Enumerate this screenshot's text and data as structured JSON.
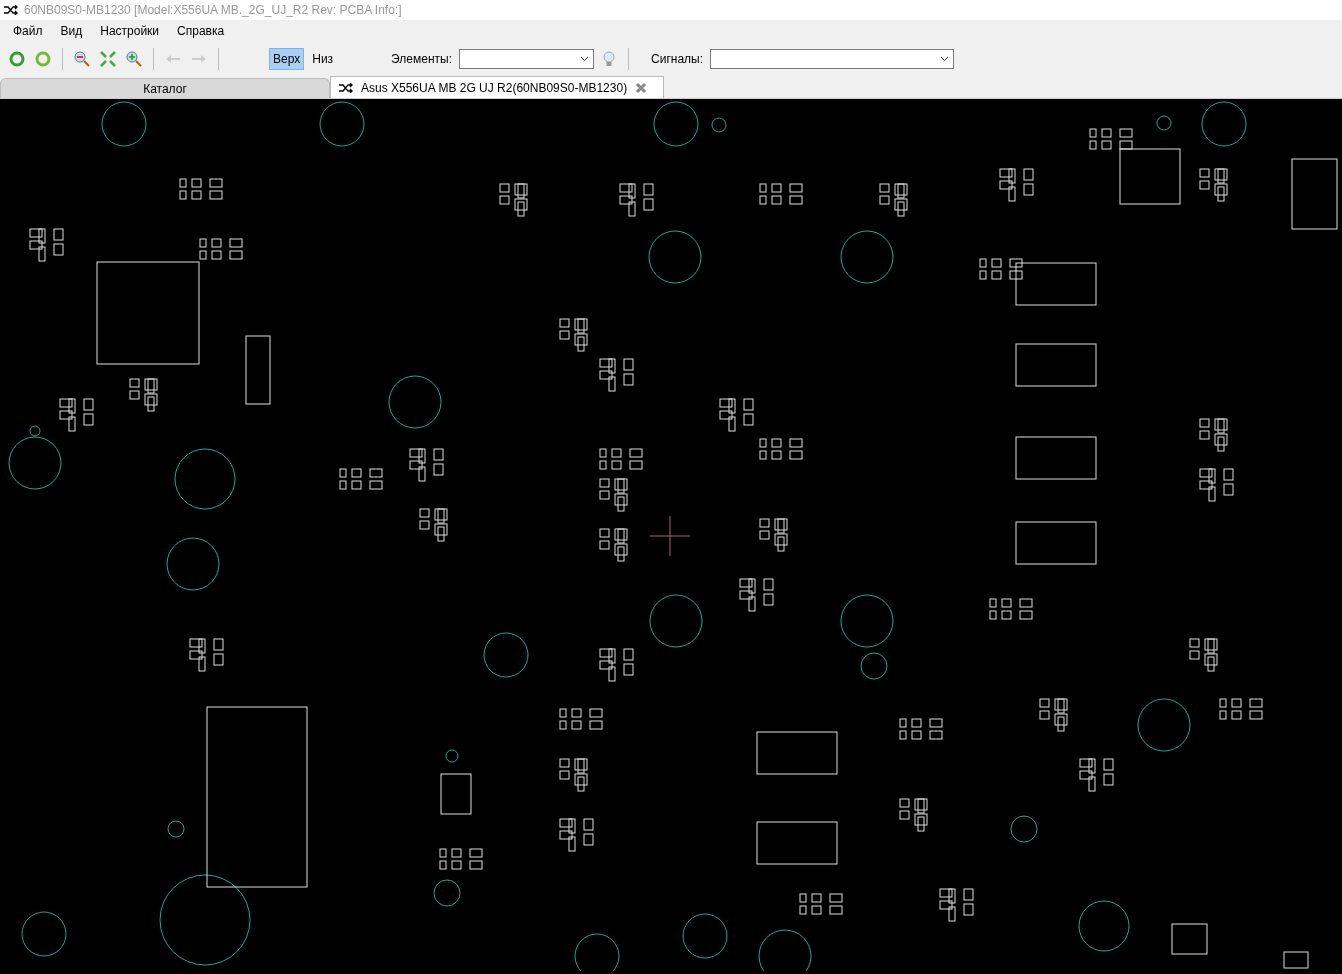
{
  "window": {
    "title": "60NB09S0-MB1230 [Model:X556UA MB._2G_UJ_R2 Rev: PCBA Info:]"
  },
  "menu": [
    "Файл",
    "Вид",
    "Настройки",
    "Справка"
  ],
  "sides": [
    {
      "label": "Верх",
      "selected": true
    },
    {
      "label": "Низ",
      "selected": false
    }
  ],
  "elements_field": {
    "label": "Элементы:"
  },
  "signals_field": {
    "label": "Сигналы:"
  },
  "tabs": [
    {
      "label": "Каталог",
      "selected": false
    },
    {
      "label": "Asus X556UA MB 2G UJ R2(60NB09S0-MB1230)",
      "selected": true
    }
  ]
}
